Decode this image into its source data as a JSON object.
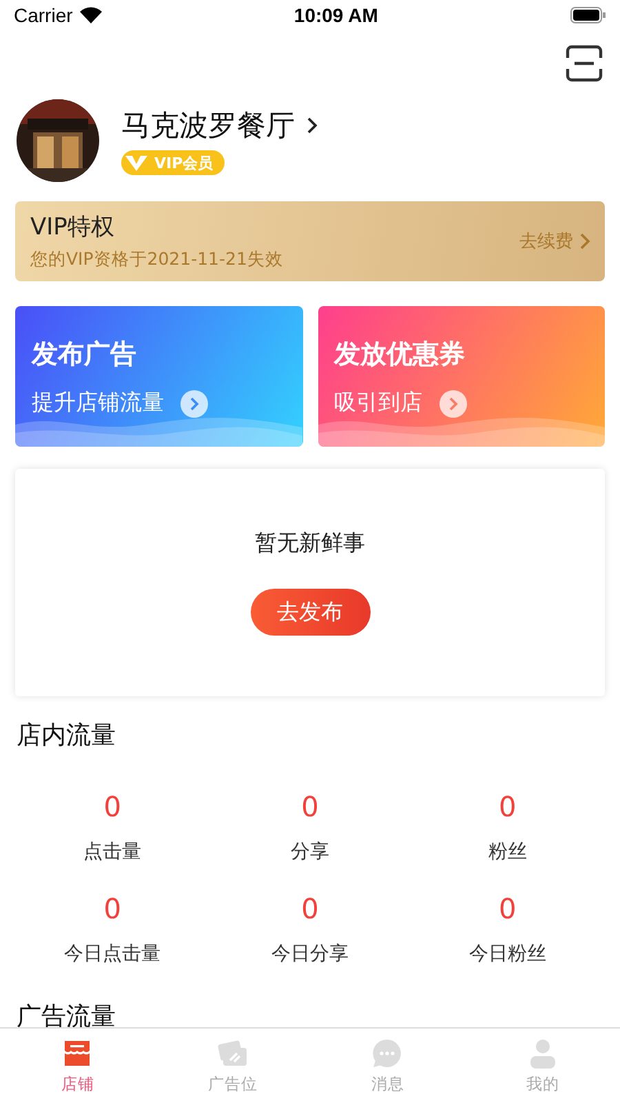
{
  "status_bar": {
    "carrier": "Carrier",
    "time": "10:09 AM"
  },
  "profile": {
    "name": "马克波罗餐厅",
    "badge": "VIP会员"
  },
  "vip": {
    "title": "VIP特权",
    "subtitle": "您的VIP资格于2021-11-21失效",
    "action": "去续费"
  },
  "actions": [
    {
      "title": "发布广告",
      "subtitle": "提升店铺流量",
      "kind": "blue"
    },
    {
      "title": "发放优惠券",
      "subtitle": "吸引到店",
      "kind": "orange"
    }
  ],
  "news": {
    "empty_text": "暂无新鲜事",
    "button": "去发布"
  },
  "store_traffic": {
    "title": "店内流量",
    "stats": [
      {
        "value": "0",
        "label": "点击量"
      },
      {
        "value": "0",
        "label": "分享"
      },
      {
        "value": "0",
        "label": "粉丝"
      },
      {
        "value": "0",
        "label": "今日点击量"
      },
      {
        "value": "0",
        "label": "今日分享"
      },
      {
        "value": "0",
        "label": "今日粉丝"
      }
    ]
  },
  "ad_traffic": {
    "title": "广告流量"
  },
  "tab_bar": [
    {
      "label": "店铺",
      "kind": "store",
      "selected": true
    },
    {
      "label": "广告位",
      "kind": "ads",
      "selected": false
    },
    {
      "label": "消息",
      "kind": "chat",
      "selected": false
    },
    {
      "label": "我的",
      "kind": "user",
      "selected": false
    }
  ]
}
